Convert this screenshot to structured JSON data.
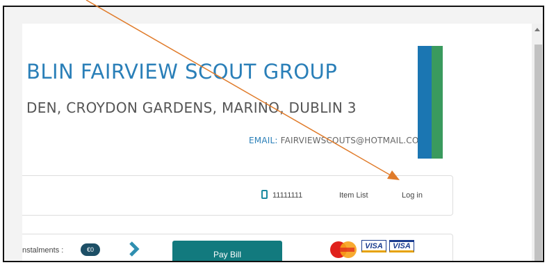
{
  "header": {
    "title": "BLIN FAIRVIEW SCOUT GROUP",
    "address": "DEN, CROYDON GARDENS, MARINO, DUBLIN 3",
    "email_label": "EMAIL:",
    "email_value": "FAIRVIEWSCOUTS@HOTMAIL.COM",
    "brand_colors": [
      "#1b76b2",
      "#3a9a5e"
    ]
  },
  "nav": {
    "phone_icon": "mobile-phone-icon",
    "phone": "11111111",
    "item_list": "Item List",
    "login": "Log in"
  },
  "payment": {
    "instalments_label": "nstalments :",
    "instalments_badge": "€0",
    "pay_button": "Pay Bill",
    "cards": [
      "mastercard",
      "visa",
      "visa-electron"
    ],
    "visa_label": "VISA"
  },
  "annotation": {
    "type": "arrow",
    "color": "#e07b2a",
    "points_to": "login-link"
  }
}
